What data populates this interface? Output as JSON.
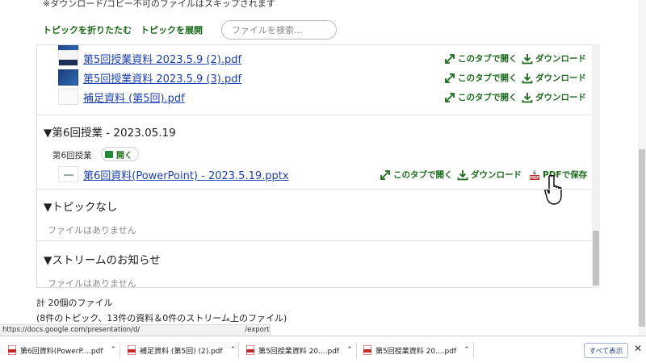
{
  "header": {
    "note": "※ダウンロード/コピー不可のファイルはスキップされます",
    "collapse_label": "トピックを折りたたむ",
    "expand_label": "トピックを展開",
    "search_placeholder": "ファイルを検索..."
  },
  "actions": {
    "open_tab": "このタブで開く",
    "download": "ダウンロード",
    "save_pdf": "PDFで保存"
  },
  "files_top": [
    {
      "name": "第5回授業資料 2023.5.9 (2).pdf"
    },
    {
      "name": "第5回授業資料 2023.5.9 (3).pdf"
    },
    {
      "name": "補足資料 (第5回).pdf"
    }
  ],
  "topic6": {
    "title": "▼第6回授業 - 2023.05.19",
    "sub": "第6回授業",
    "open_label": "開く",
    "file": "第6回資料(PowerPoint) - 2023.5.19.pptx"
  },
  "no_topic": {
    "title": "▼トピックなし",
    "empty": "ファイルはありません"
  },
  "stream": {
    "title": "▼ストリームのお知らせ",
    "empty": "ファイルはありません"
  },
  "summary": {
    "total": "計 20個のファイル",
    "detail": "(8件のトピック、13件の資料＆0件のストリーム上のファイル)"
  },
  "status": {
    "url_left": "https://docs.google.com/presentation/d/",
    "url_right": "/export?format=pdf"
  },
  "downloads": {
    "items": [
      {
        "name": "第6回資料(PowerP....pdf"
      },
      {
        "name": "補足資料 (第5回) (2).pdf"
      },
      {
        "name": "第5回授業資料 20....pdf"
      },
      {
        "name": "第5回授業資料 20....pdf"
      }
    ],
    "show_all": "すべて表示",
    "close": "✕"
  },
  "colors": {
    "link": "#1a3fb0",
    "action_green": "#1a6b1a",
    "pdf_red": "#c62828"
  }
}
